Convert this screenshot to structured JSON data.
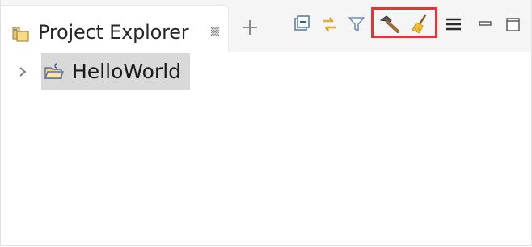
{
  "view": {
    "title": "Project Explorer",
    "icons": {
      "tab": "project-explorer-icon",
      "close": "close-view-icon",
      "add": "new-view-plus-icon"
    }
  },
  "toolbar": {
    "buttons": [
      {
        "name": "collapse-all-icon"
      },
      {
        "name": "link-with-editor-icon"
      },
      {
        "name": "filter-icon"
      },
      {
        "name": "build-hammer-icon"
      },
      {
        "name": "clean-broom-icon"
      },
      {
        "name": "view-menu-icon"
      },
      {
        "name": "minimize-icon"
      },
      {
        "name": "maximize-icon"
      }
    ],
    "highlight_color": "#e63333"
  },
  "tree": {
    "items": [
      {
        "label": "HelloWorld",
        "expanded": false,
        "selected": true,
        "icon": "java-project-folder-icon"
      }
    ]
  }
}
